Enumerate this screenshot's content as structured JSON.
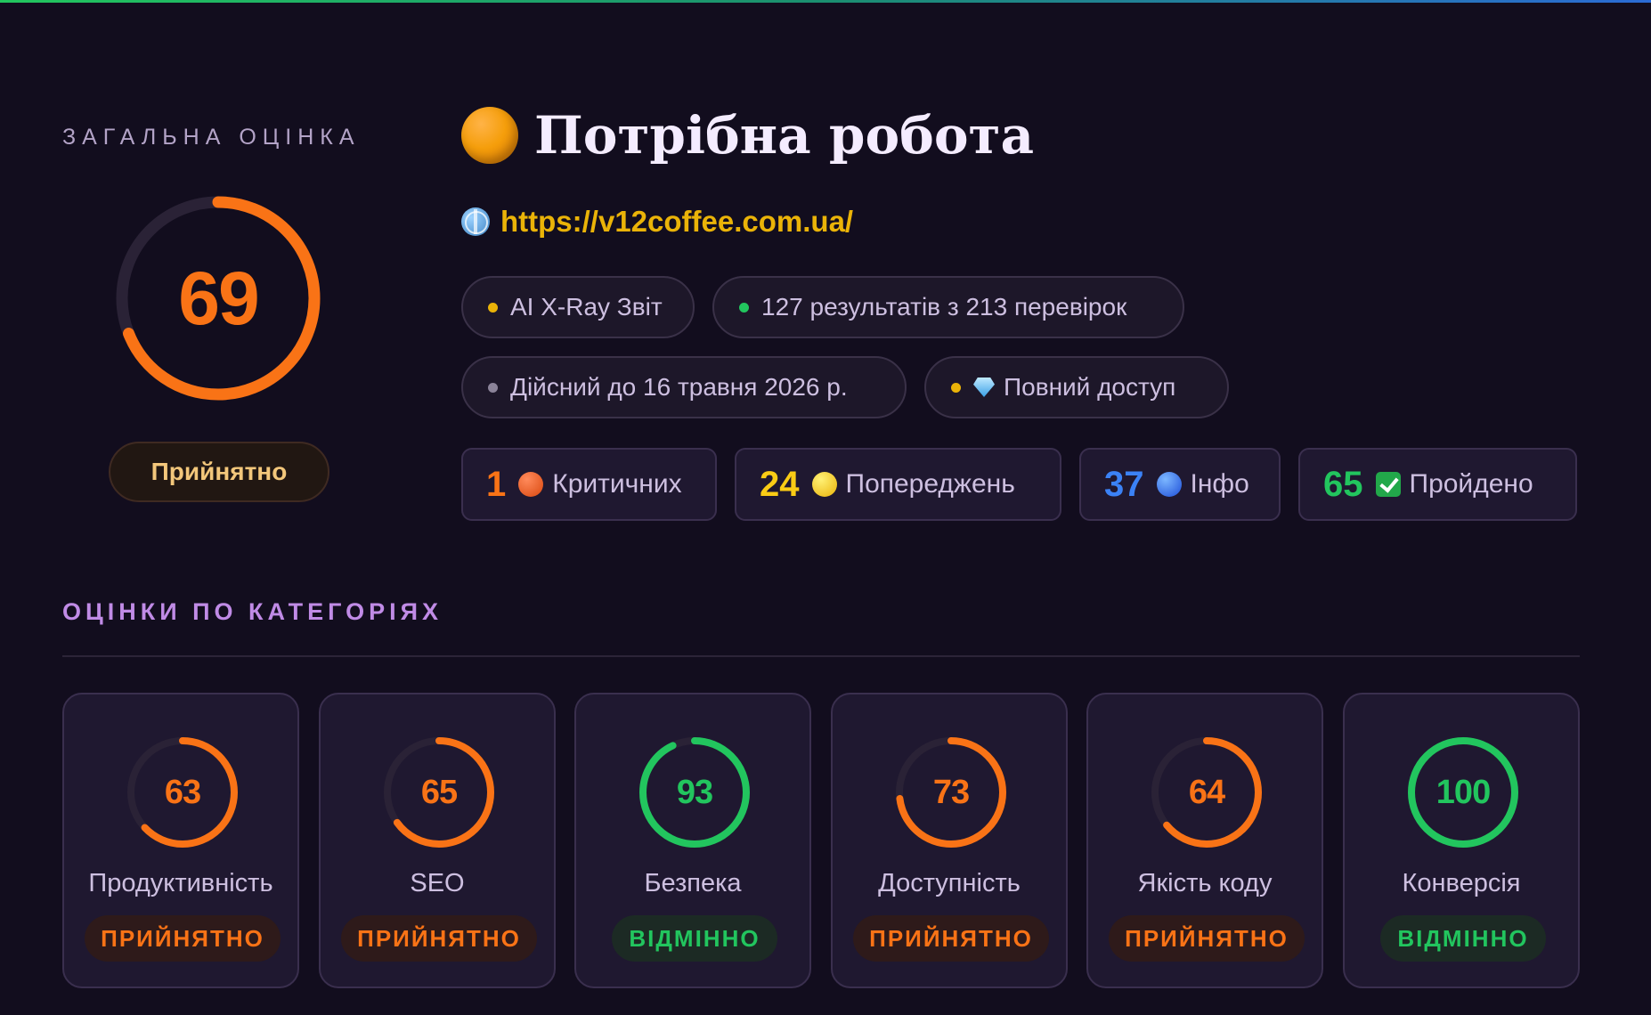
{
  "colors": {
    "orange": "#f97316",
    "green": "#22c55e",
    "blue": "#3b82f6",
    "yellow": "#eab308",
    "track": "#2a2236"
  },
  "overall": {
    "label": "ЗАГАЛЬНА ОЦІНКА",
    "score": "69",
    "score_value": 69,
    "badge": "Прийнятно"
  },
  "header": {
    "title": "Потрібна робота",
    "status_icon": "orange-circle-icon",
    "url": "https://v12coffee.com.ua/",
    "url_icon": "globe-icon"
  },
  "pills": [
    {
      "label": "AI X-Ray Звіт",
      "dot_color": "#eab308"
    },
    {
      "label": "127 результатів з 213 перевірок",
      "dot_color": "#22c55e"
    },
    {
      "label": "Дійсний до 16 травня 2026 р.",
      "dot_color": "#8b8399"
    },
    {
      "label": "Повний доступ",
      "dot_color": "#eab308",
      "icon": "gem-icon"
    }
  ],
  "stats": [
    {
      "count": "1",
      "label": "Критичних",
      "color": "#f97316",
      "icon": "red-circle-icon"
    },
    {
      "count": "24",
      "label": "Попереджень",
      "color": "#facc15",
      "icon": "yellow-circle-icon"
    },
    {
      "count": "37",
      "label": "Інфо",
      "color": "#3b82f6",
      "icon": "blue-circle-icon"
    },
    {
      "count": "65",
      "label": "Пройдено",
      "color": "#22c55e",
      "icon": "check-icon"
    }
  ],
  "categories": {
    "title": "ОЦІНКИ ПО КАТЕГОРІЯХ",
    "items": [
      {
        "score": "63",
        "value": 63,
        "label": "Продуктивність",
        "badge": "ПРИЙНЯТНО",
        "tone": "orange"
      },
      {
        "score": "65",
        "value": 65,
        "label": "SEO",
        "badge": "ПРИЙНЯТНО",
        "tone": "orange"
      },
      {
        "score": "93",
        "value": 93,
        "label": "Безпека",
        "badge": "ВІДМІННО",
        "tone": "green"
      },
      {
        "score": "73",
        "value": 73,
        "label": "Доступність",
        "badge": "ПРИЙНЯТНО",
        "tone": "orange"
      },
      {
        "score": "64",
        "value": 64,
        "label": "Якість коду",
        "badge": "ПРИЙНЯТНО",
        "tone": "orange"
      },
      {
        "score": "100",
        "value": 100,
        "label": "Конверсія",
        "badge": "ВІДМІННО",
        "tone": "green"
      }
    ]
  }
}
